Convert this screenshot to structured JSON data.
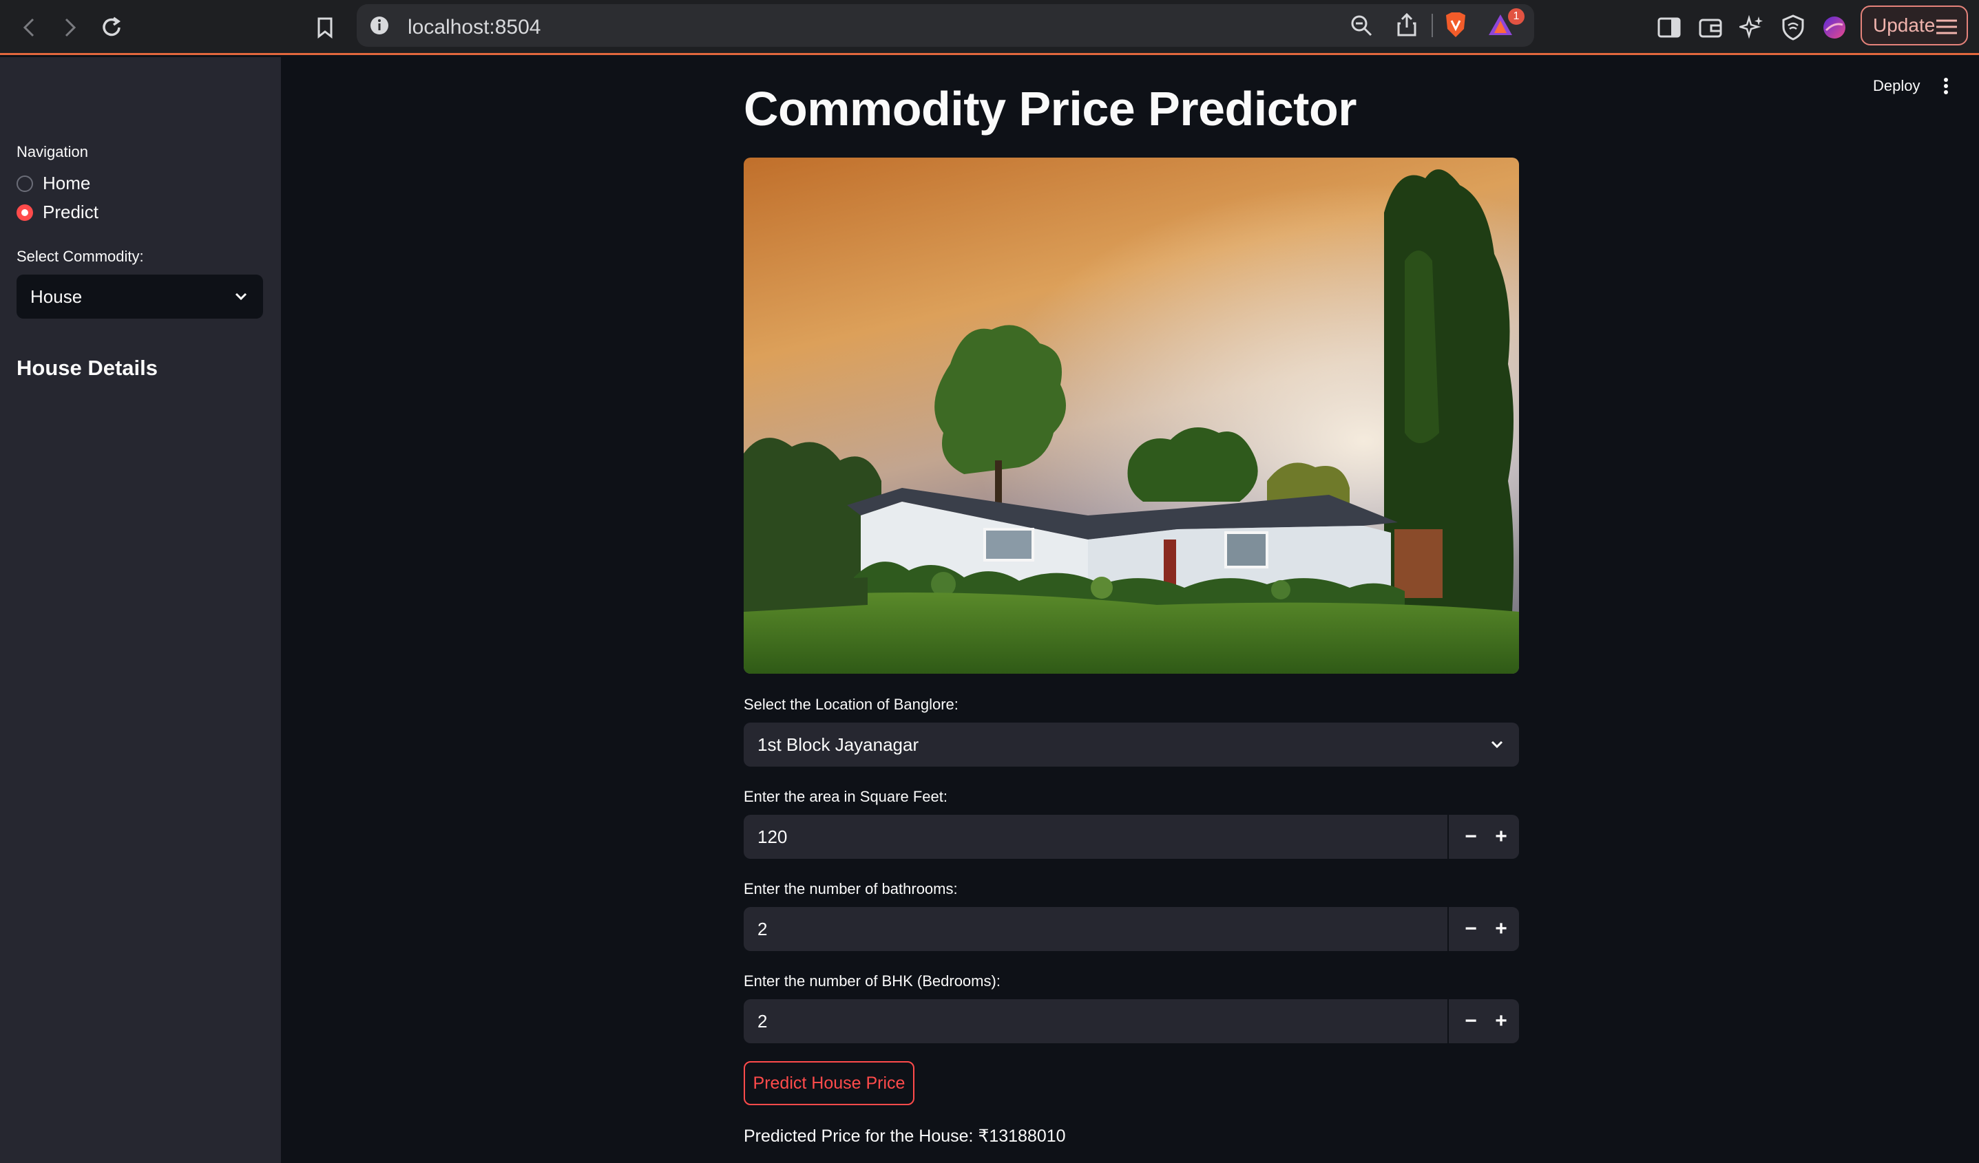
{
  "browser": {
    "url": "localhost:8504",
    "update_label": "Update",
    "notification_count": "1"
  },
  "sidebar": {
    "nav_title": "Navigation",
    "nav_options": [
      {
        "label": "Home",
        "selected": false
      },
      {
        "label": "Predict",
        "selected": true
      }
    ],
    "commodity_label": "Select Commodity:",
    "commodity_value": "House",
    "section_heading": "House Details"
  },
  "toolbar": {
    "deploy_label": "Deploy"
  },
  "main": {
    "title": "Commodity Price Predictor",
    "location_label": "Select the Location of Banglore:",
    "location_value": "1st Block Jayanagar",
    "area_label": "Enter the area in Square Feet:",
    "area_value": "120",
    "bath_label": "Enter the number of bathrooms:",
    "bath_value": "2",
    "bhk_label": "Enter the number of BHK (Bedrooms):",
    "bhk_value": "2",
    "stepper_minus": "−",
    "stepper_plus": "+",
    "predict_button": "Predict House Price",
    "result_text": "Predicted Price for the House: ₹13188010"
  },
  "colors": {
    "accent": "#ff4b4b",
    "background": "#0e1117",
    "sidebar": "#262730",
    "chrome_accent": "#e2673d"
  }
}
